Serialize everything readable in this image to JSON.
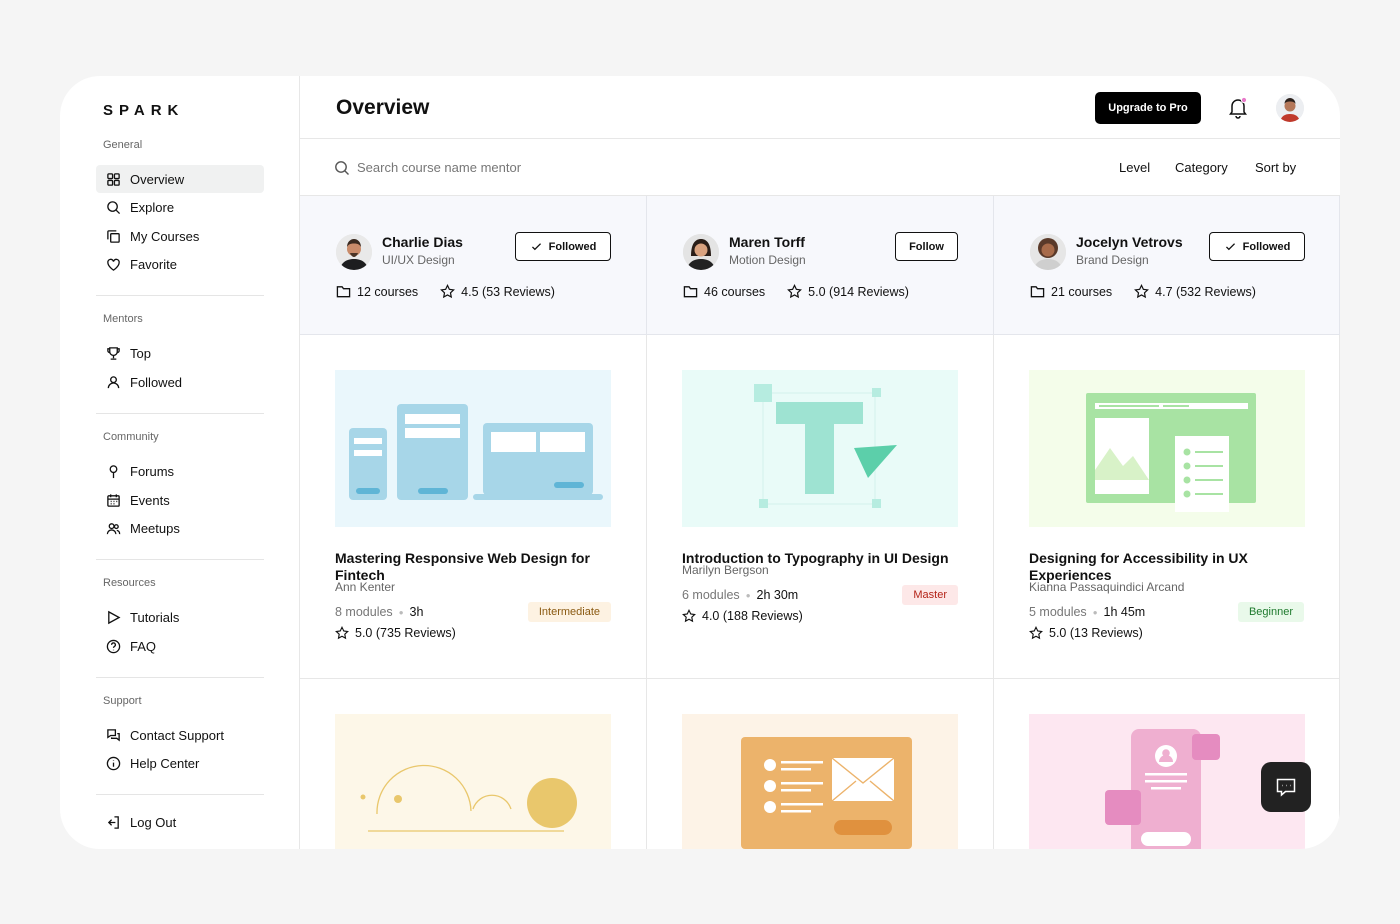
{
  "app": {
    "logo": "SPARK"
  },
  "sidebar": {
    "sections": [
      {
        "title": "General",
        "items": [
          {
            "label": "Overview",
            "icon": "grid-icon",
            "active": true
          },
          {
            "label": "Explore",
            "icon": "search-icon"
          },
          {
            "label": "My Courses",
            "icon": "copy-icon"
          },
          {
            "label": "Favorite",
            "icon": "heart-icon"
          }
        ]
      },
      {
        "title": "Mentors",
        "items": [
          {
            "label": "Top",
            "icon": "trophy-icon"
          },
          {
            "label": "Followed",
            "icon": "user-icon"
          }
        ]
      },
      {
        "title": "Community",
        "items": [
          {
            "label": "Forums",
            "icon": "pin-icon"
          },
          {
            "label": "Events",
            "icon": "calendar-icon"
          },
          {
            "label": "Meetups",
            "icon": "users-icon"
          }
        ]
      },
      {
        "title": "Resources",
        "items": [
          {
            "label": "Tutorials",
            "icon": "play-icon"
          },
          {
            "label": "FAQ",
            "icon": "question-icon"
          }
        ]
      },
      {
        "title": "Support",
        "items": [
          {
            "label": "Contact Support",
            "icon": "chat-icon"
          },
          {
            "label": "Help Center",
            "icon": "info-icon"
          }
        ]
      }
    ],
    "logout": {
      "label": "Log Out",
      "icon": "logout-icon"
    }
  },
  "header": {
    "title": "Overview",
    "upgrade_label": "Upgrade to Pro"
  },
  "search": {
    "placeholder": "Search course name mentor",
    "filters": [
      "Level",
      "Category",
      "Sort by"
    ]
  },
  "mentors": [
    {
      "name": "Charlie Dias",
      "role": "UI/UX Design",
      "follow_label": "Followed",
      "followed": true,
      "courses": "12 courses",
      "rating": "4.5",
      "reviews": "(53 Reviews)"
    },
    {
      "name": "Maren Torff",
      "role": "Motion Design",
      "follow_label": "Follow",
      "followed": false,
      "courses": "46 courses",
      "rating": "5.0",
      "reviews": "(914 Reviews)"
    },
    {
      "name": "Jocelyn Vetrovs",
      "role": "Brand Design",
      "follow_label": "Followed",
      "followed": true,
      "courses": "21 courses",
      "rating": "4.7",
      "reviews": "(532 Reviews)"
    }
  ],
  "courses": [
    {
      "title": "Mastering Responsive Web Design for Fintech",
      "mentor": "Ann Kenter",
      "modules": "8 modules",
      "duration": "3h",
      "level": "Intermediate",
      "rating": "5.0",
      "reviews": "(735 Reviews)"
    },
    {
      "title": "Introduction to Typography in UI Design",
      "mentor": "Marilyn Bergson",
      "modules": "6 modules",
      "duration": "2h 30m",
      "level": "Master",
      "rating": "4.0",
      "reviews": "(188 Reviews)"
    },
    {
      "title": "Designing for Accessibility in UX Experiences",
      "mentor": "Kianna Passaquindici Arcand",
      "modules": "5 modules",
      "duration": "1h 45m",
      "level": "Beginner",
      "rating": "5.0",
      "reviews": "(13 Reviews)"
    }
  ],
  "colors": {
    "intermediate_bg": "#fdf2e2",
    "intermediate_fg": "#8a5a12",
    "master_bg": "#fde8e8",
    "master_fg": "#b42318",
    "beginner_bg": "#e9f9ea",
    "beginner_fg": "#1f7a2e"
  }
}
